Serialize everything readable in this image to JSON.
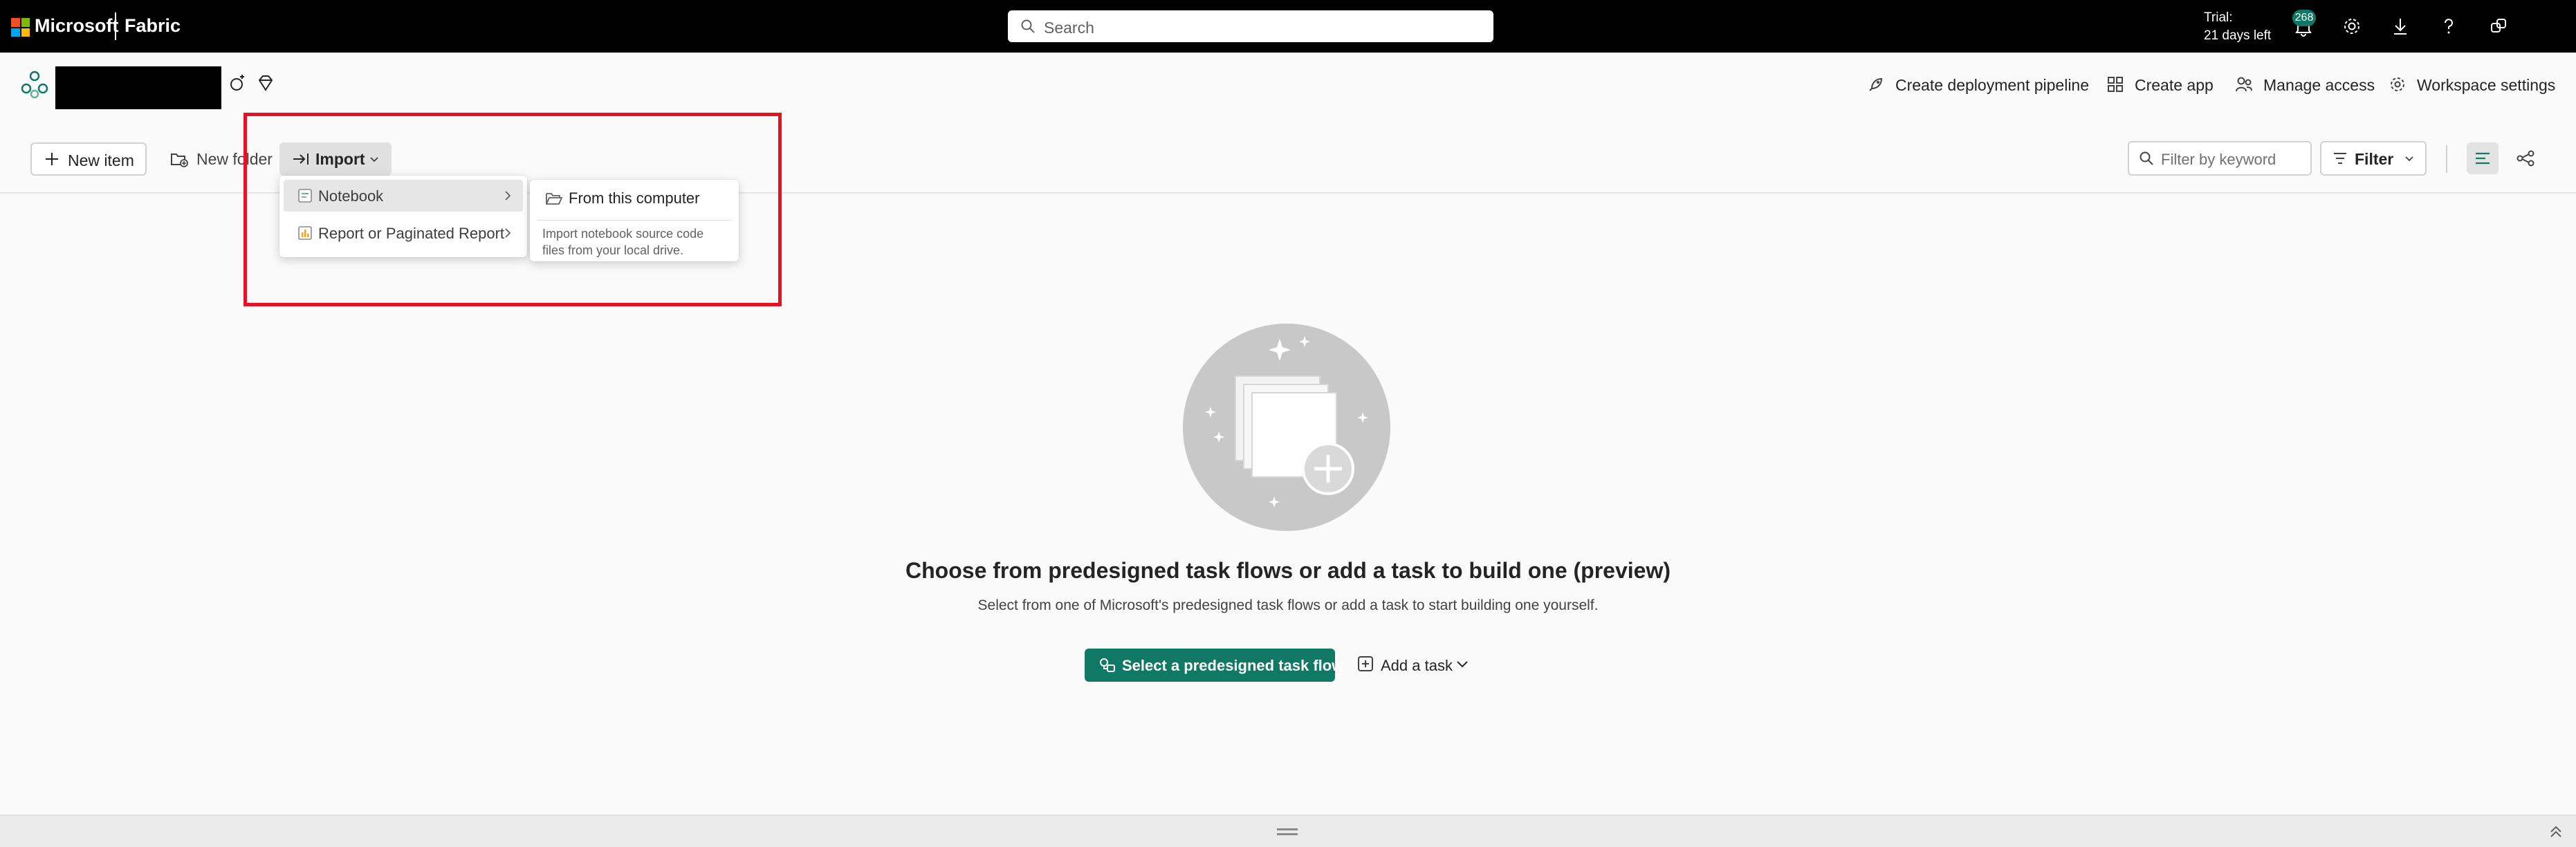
{
  "topbar": {
    "brand": "Microsoft",
    "product": "Fabric",
    "search_placeholder": "Search",
    "trial_line1": "Trial:",
    "trial_line2": "21 days left",
    "notification_count": "268",
    "icons": [
      "notifications-icon",
      "settings-icon",
      "download-icon",
      "help-icon",
      "share-icon"
    ],
    "accent_color": "#117865"
  },
  "workspace": {
    "actions": {
      "deployment": "Create deployment pipeline",
      "create_app": "Create app",
      "manage_access": "Manage access",
      "settings": "Workspace settings"
    }
  },
  "toolbar": {
    "new_item": "New item",
    "new_folder": "New folder",
    "import": "Import",
    "filter_placeholder": "Filter by keyword",
    "filter": "Filter"
  },
  "import_menu": {
    "items": [
      {
        "label": "Notebook"
      },
      {
        "label": "Report or Paginated Report"
      }
    ],
    "submenu": {
      "item": "From this computer",
      "description": "Import notebook source code files from your local drive."
    }
  },
  "empty_state": {
    "title": "Choose from predesigned task flows or add a task to build one (preview)",
    "subtitle": "Select from one of Microsoft's predesigned task flows or add a task to start building one yourself.",
    "primary_button": "Select a predesigned task flow",
    "secondary_button": "Add a task"
  },
  "highlight_color": "#e81123"
}
